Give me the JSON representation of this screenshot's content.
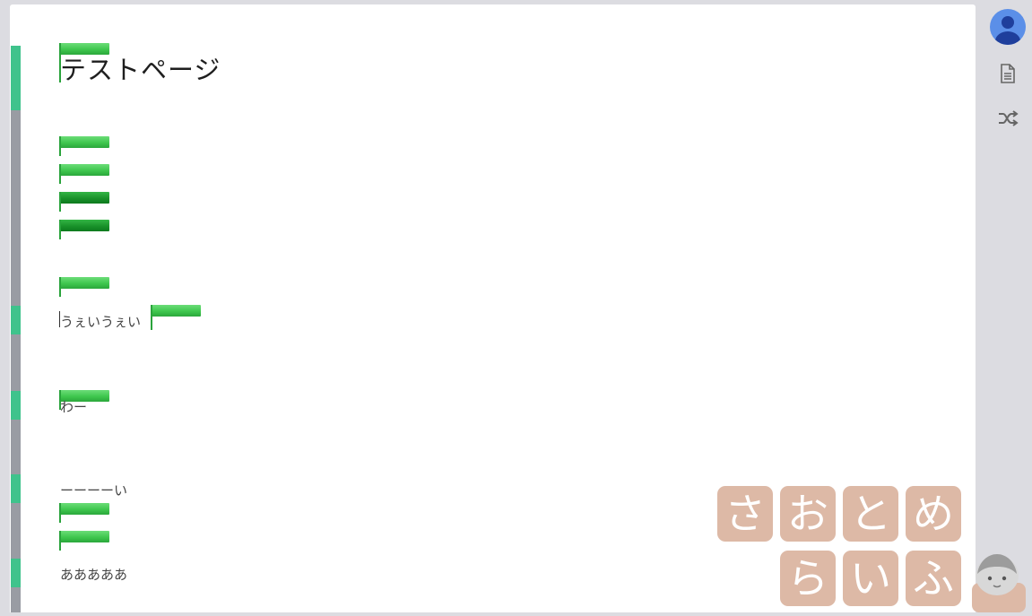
{
  "page": {
    "title": "テストページ",
    "lines": {
      "l1": "うぇいうぇい",
      "l2": "わー",
      "l3": "ーーーーい",
      "l4": "あああああ"
    }
  },
  "sidebar": {
    "profile_icon": "user-avatar-icon",
    "doc_icon": "document-icon",
    "shuffle_icon": "shuffle-icon"
  },
  "watermark": {
    "row1": [
      "さ",
      "お",
      "と",
      "め"
    ],
    "row2": [
      "ら",
      "い",
      "ふ"
    ]
  },
  "colors": {
    "cursor_flag": "#3fc74e",
    "gutter": "#999ca3",
    "gutter_highlight": "#3fc38c",
    "avatar": "#5b8fe8",
    "logo_tile": "#ddb9a6"
  }
}
